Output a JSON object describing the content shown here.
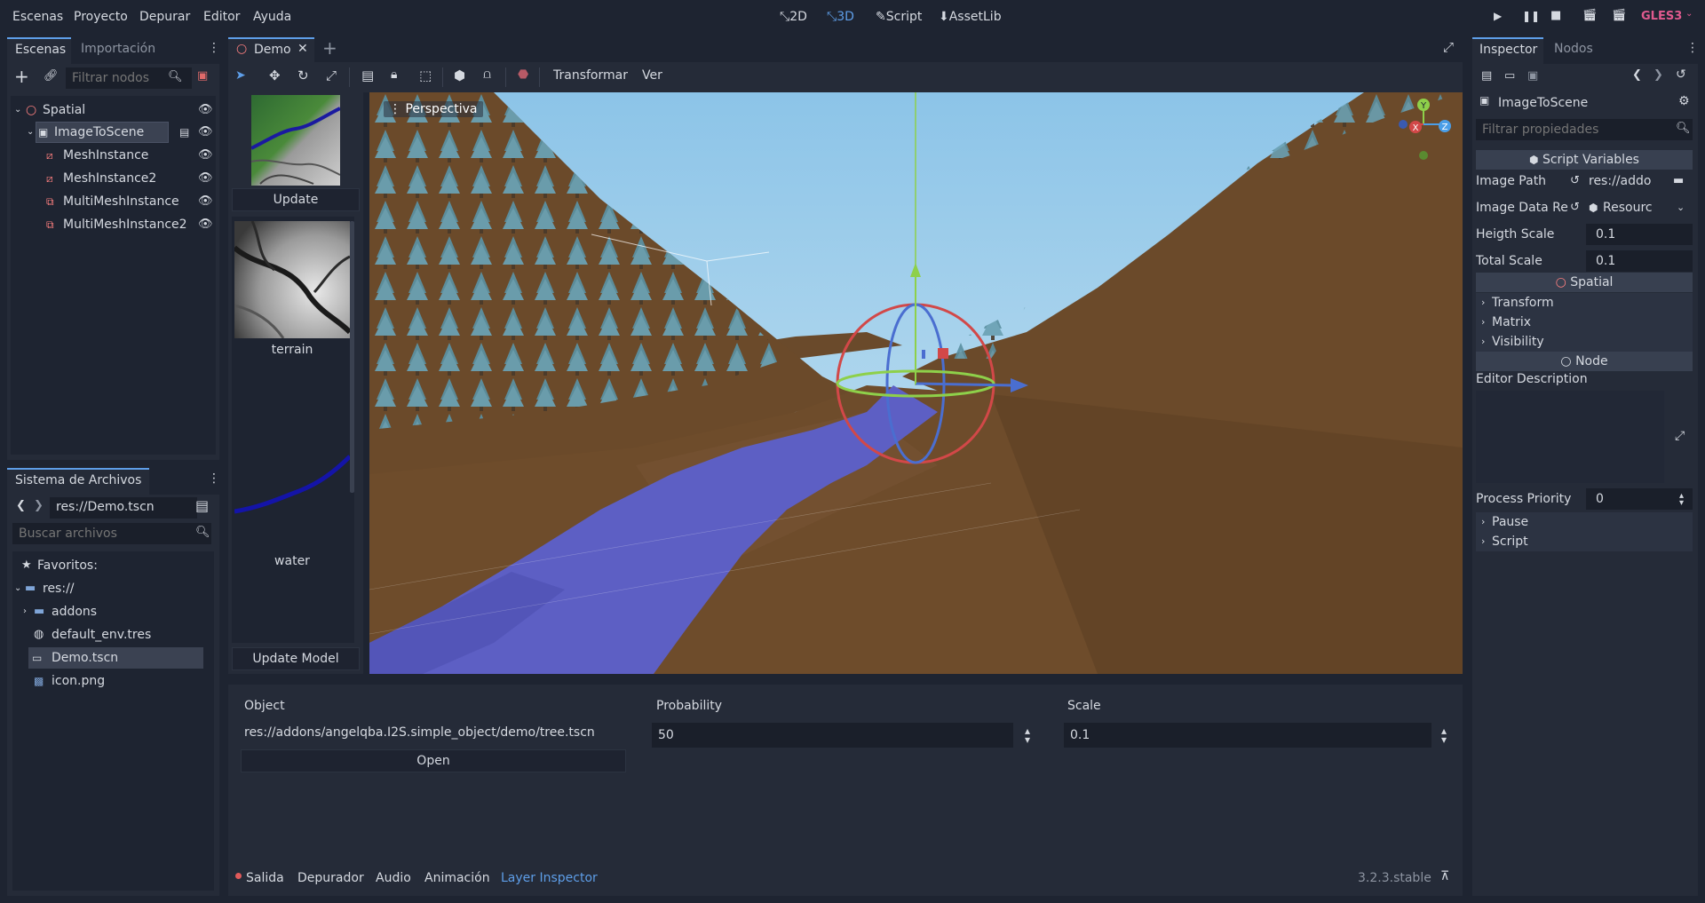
{
  "menubar": {
    "items": [
      "Escenas",
      "Proyecto",
      "Depurar",
      "Editor",
      "Ayuda"
    ],
    "modes": [
      "2D",
      "3D",
      "Script",
      "AssetLib"
    ],
    "renderer": "GLES3"
  },
  "scene_dock": {
    "tabs": [
      "Escenas",
      "Importación"
    ],
    "filter_placeholder": "Filtrar nodos",
    "nodes": [
      "Spatial",
      "ImageToScene",
      "MeshInstance",
      "MeshInstance2",
      "MultiMeshInstance",
      "MultiMeshInstance2"
    ]
  },
  "filesystem_dock": {
    "title": "Sistema de Archivos",
    "path": "res://Demo.tscn",
    "search_placeholder": "Buscar archivos",
    "items": [
      "Favoritos:",
      "res://",
      "addons",
      "default_env.tres",
      "Demo.tscn",
      "icon.png"
    ]
  },
  "scene_tab": {
    "label": "Demo"
  },
  "toolbar": {
    "transform": "Transformar",
    "view": "Ver"
  },
  "layer_panel": {
    "update_label": "Update",
    "layers": [
      "terrain",
      "water"
    ],
    "update_model_label": "Update Model"
  },
  "viewport": {
    "perspective": "Perspectiva",
    "gizmo_labels": [
      "Y",
      "X",
      "Z"
    ]
  },
  "object_panel": {
    "object_label": "Object",
    "object_path": "res://addons/angelqba.I2S.simple_object/demo/tree.tscn",
    "open_label": "Open",
    "probability_label": "Probability",
    "probability_value": "50",
    "scale_label": "Scale",
    "scale_value": "0.1"
  },
  "bottom_bar": {
    "tabs": [
      "Salida",
      "Depurador",
      "Audio",
      "Animación",
      "Layer Inspector"
    ],
    "version": "3.2.3.stable"
  },
  "inspector": {
    "tabs": [
      "Inspector",
      "Nodos"
    ],
    "node_name": "ImageToScene",
    "filter_placeholder": "Filtrar propiedades",
    "script_variables": "Script Variables",
    "image_path_label": "Image Path",
    "image_path_value": "res://addo",
    "image_data_label": "Image Data Re",
    "image_data_value": "Resourc",
    "heigth_scale_label": "Heigth Scale",
    "heigth_scale_value": "0.1",
    "total_scale_label": "Total Scale",
    "total_scale_value": "0.1",
    "spatial_section": "Spatial",
    "spatial_groups": [
      "Transform",
      "Matrix",
      "Visibility"
    ],
    "node_section": "Node",
    "editor_description": "Editor Description",
    "process_priority_label": "Process Priority",
    "process_priority_value": "0",
    "node_groups": [
      "Pause",
      "Script"
    ]
  },
  "colors": {
    "accent": "#5e9ee8",
    "background": "#1e2431",
    "panel": "#252b38",
    "sky": "#a8d4ec",
    "terrain": "#6b4a2a",
    "water": "#5d5fc4"
  }
}
